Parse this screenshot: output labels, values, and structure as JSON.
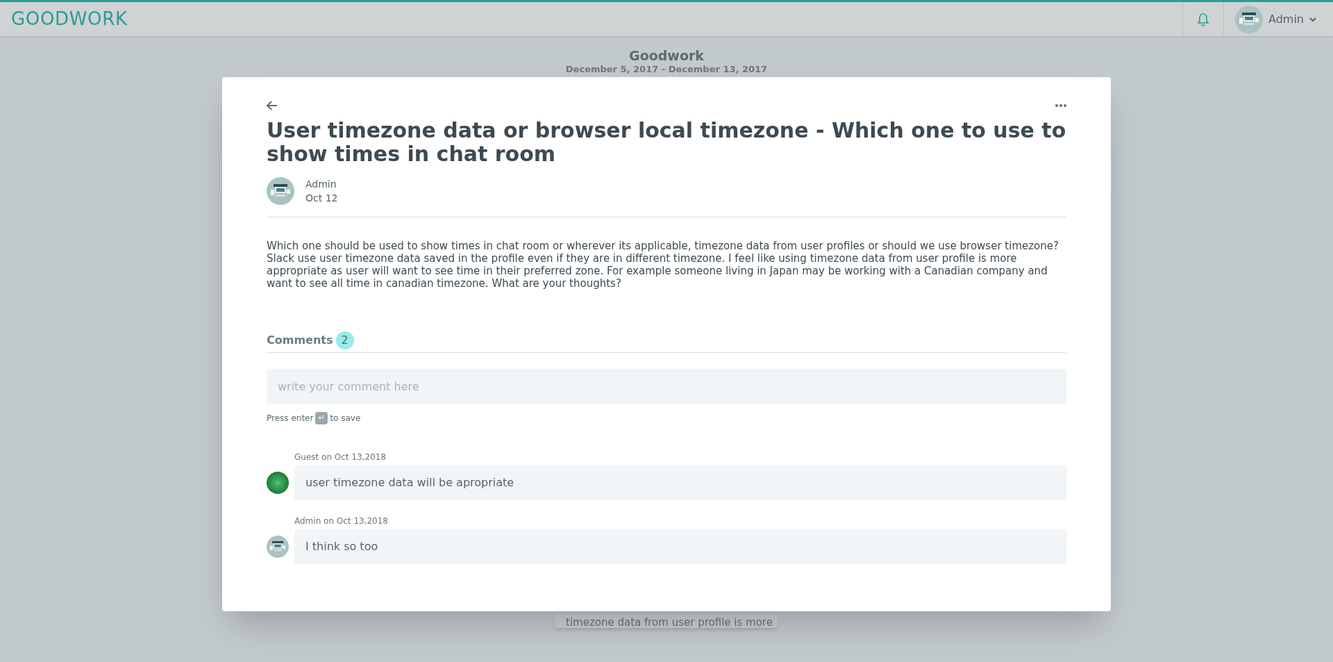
{
  "navbar": {
    "logo": "GOODWORK",
    "user": "Admin"
  },
  "page": {
    "title": "Goodwork",
    "dates": "December 5, 2017 - December 13, 2017",
    "card_text": "timezone data from user profile is more"
  },
  "modal": {
    "title": "User timezone data or browser local timezone - Which one to use to show times in chat room",
    "author": "Admin",
    "date": "Oct 12",
    "body": "Which one should be used to show times in chat room or wherever its applicable, timezone data from user profiles or should we use browser timezone? Slack use user timezone data saved in the profile even if they are in different timezone. I feel like using timezone data from user profile is more appropriate as user will want to see time in their preferred zone. For example someone living in Japan may be working with a Canadian company and want to see all time in canadian timezone. What are your thoughts?",
    "comments_label": "Comments",
    "comments_count": "2",
    "comment_field": {
      "placeholder": "write your comment here"
    },
    "hint_before": "Press enter",
    "hint_key": "↵",
    "hint_after": "to save",
    "comments": [
      {
        "kind": "guest",
        "meta": "Guest on Oct 13,2018",
        "text": "user timezone data will be apropriate"
      },
      {
        "kind": "admin",
        "meta": "Admin on Oct 13,2018",
        "text": "I think so too"
      }
    ]
  }
}
